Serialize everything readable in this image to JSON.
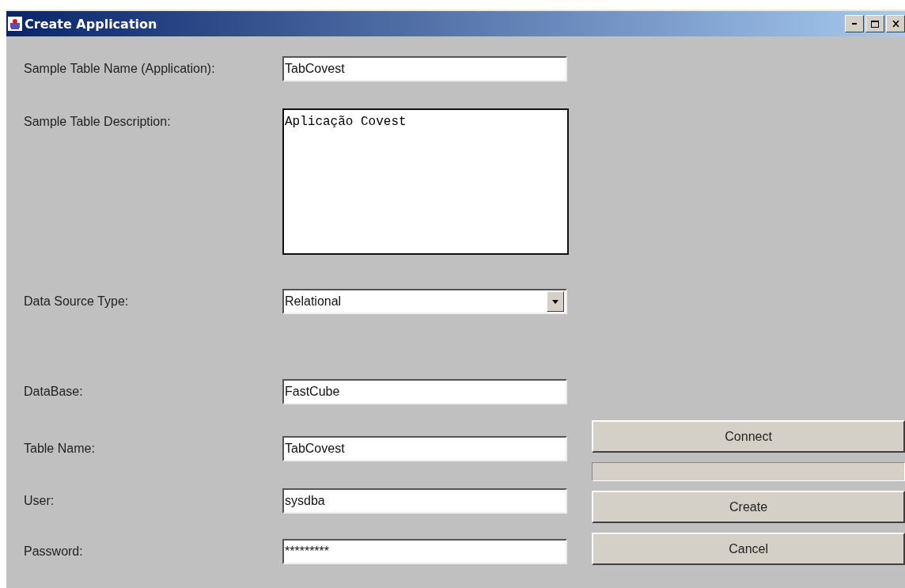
{
  "window": {
    "title": "Create Application"
  },
  "fields": [
    {
      "kind": "text",
      "label": "Sample Table Name (Application):",
      "value": "TabCovest"
    },
    {
      "kind": "textarea",
      "label": "Sample Table Description:",
      "value": "Aplicação Covest"
    },
    {
      "kind": "select",
      "label": "Data Source Type:",
      "value": "Relational"
    },
    {
      "kind": "text",
      "label": "DataBase:",
      "value": "FastCube"
    },
    {
      "kind": "text",
      "label": "Table Name:",
      "value": "TabCovest"
    },
    {
      "kind": "text",
      "label": "User:",
      "value": "sysdba"
    },
    {
      "kind": "text",
      "label": "Password:",
      "value": "*********"
    }
  ],
  "connect_button": "Connect",
  "buttons": [
    "Create",
    "Cancel"
  ]
}
